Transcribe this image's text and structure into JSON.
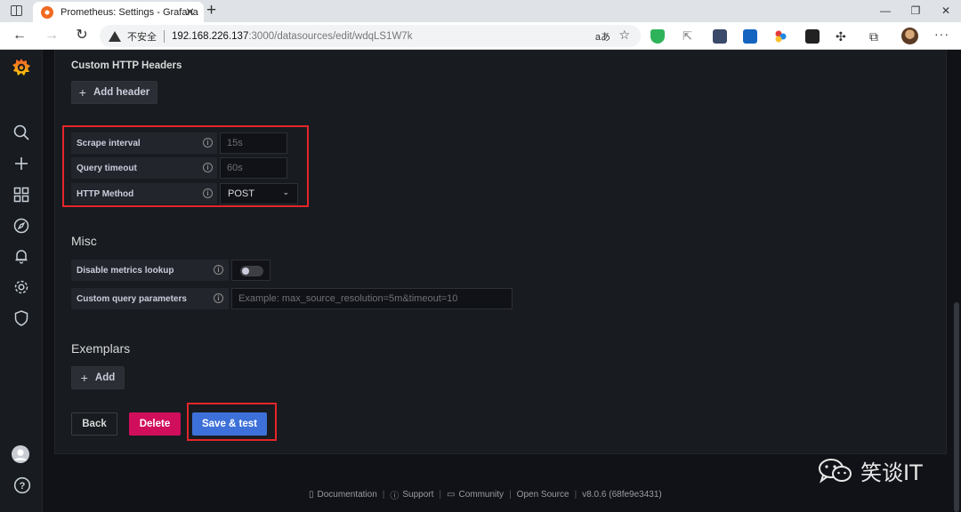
{
  "browser": {
    "tab_title": "Prometheus: Settings - Grafana",
    "tab_close": "✕",
    "new_tab": "+",
    "insecure_label": "不安全",
    "url_host": "192.168.226.137",
    "url_path": ":3000/datasources/edit/wdqLS1W7k",
    "read_aloud": "aあ"
  },
  "http_headers": {
    "title": "Custom HTTP Headers",
    "add_button": "Add header"
  },
  "settings": {
    "scrape_interval": {
      "label": "Scrape interval",
      "placeholder": "15s"
    },
    "query_timeout": {
      "label": "Query timeout",
      "placeholder": "60s"
    },
    "http_method": {
      "label": "HTTP Method",
      "value": "POST"
    }
  },
  "misc": {
    "title": "Misc",
    "disable_metrics_lookup": {
      "label": "Disable metrics lookup",
      "enabled": false
    },
    "custom_query_params": {
      "label": "Custom query parameters",
      "placeholder": "Example: max_source_resolution=5m&timeout=10"
    }
  },
  "exemplars": {
    "title": "Exemplars",
    "add_button": "Add"
  },
  "actions": {
    "back": "Back",
    "delete": "Delete",
    "save": "Save & test"
  },
  "footer": {
    "documentation": "Documentation",
    "support": "Support",
    "community": "Community",
    "open_source": "Open Source",
    "version": "v8.0.6 (68fe9e3431)"
  },
  "watermark": {
    "text": "笑谈IT"
  },
  "colors": {
    "primary": "#3d71d9",
    "danger": "#d10e5c",
    "highlight": "#e3262a"
  }
}
